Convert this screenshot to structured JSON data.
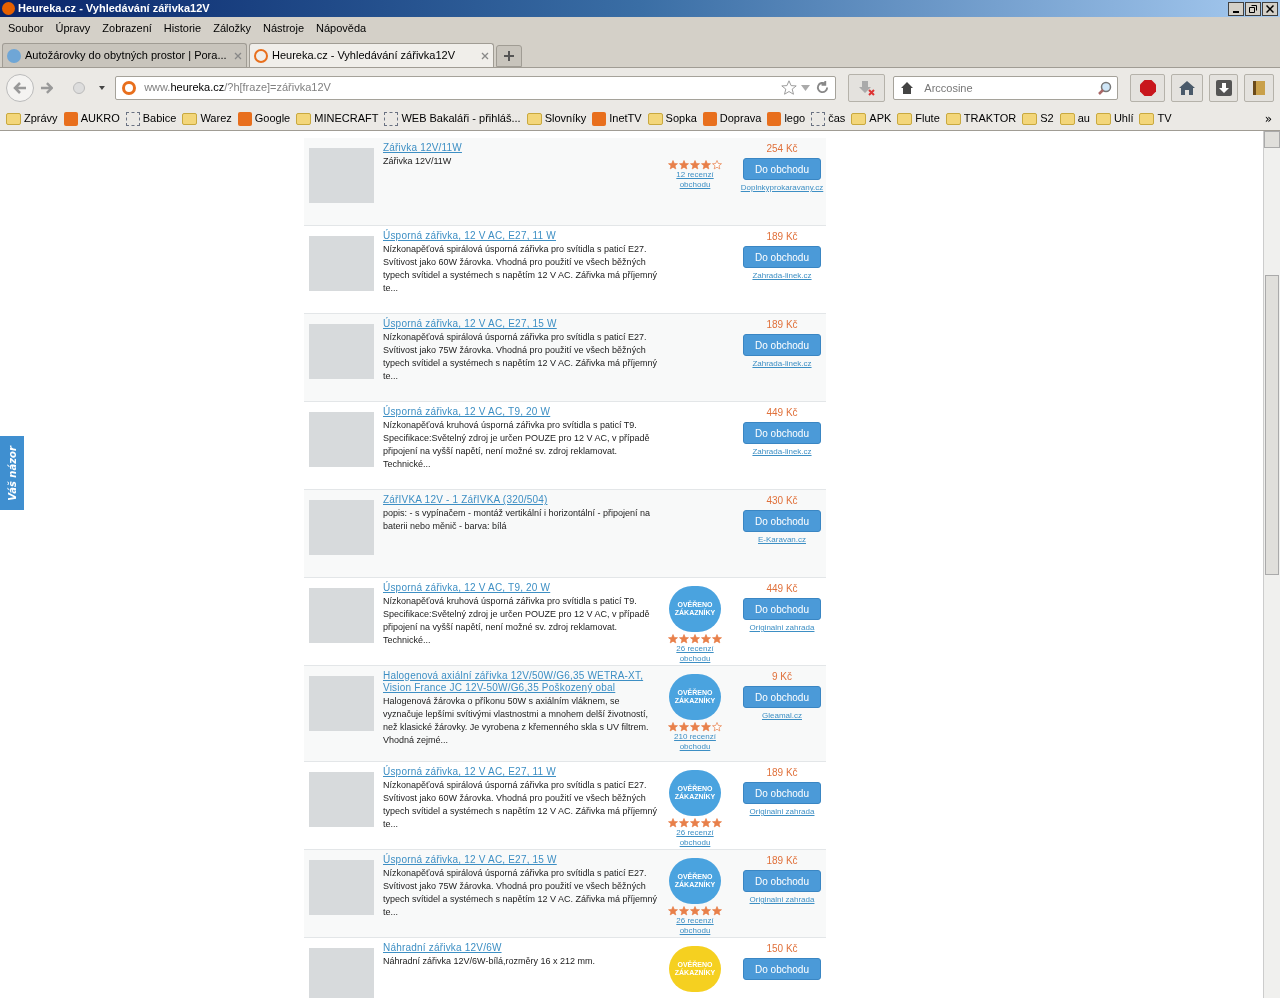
{
  "window": {
    "title": "Heureka.cz - Vyhledávání zářivka12V"
  },
  "menu": [
    "Soubor",
    "Úpravy",
    "Zobrazení",
    "Historie",
    "Záložky",
    "Nástroje",
    "Nápověda"
  ],
  "tabs": [
    {
      "label": "Autožárovky do obytných prostor | Pora...",
      "selected": false
    },
    {
      "label": "Heureka.cz - Vyhledávání zářivka12V",
      "selected": true
    }
  ],
  "address": {
    "url_start": "www.",
    "url_host": "heureka.cz",
    "url_rest": "/?h[fraze]=zářivka12V"
  },
  "search": {
    "placeholder": "Arccosine"
  },
  "bookmarks": [
    {
      "label": "Zprávy",
      "kind": "folder"
    },
    {
      "label": "AUKRO",
      "kind": "site"
    },
    {
      "label": "Babice",
      "kind": "page"
    },
    {
      "label": "Warez",
      "kind": "folder"
    },
    {
      "label": "Google",
      "kind": "site"
    },
    {
      "label": "MINECRAFT",
      "kind": "folder"
    },
    {
      "label": "WEB Bakaláři - přihláš...",
      "kind": "page"
    },
    {
      "label": "Slovníky",
      "kind": "folder"
    },
    {
      "label": "InetTV",
      "kind": "site"
    },
    {
      "label": "Sopka",
      "kind": "folder"
    },
    {
      "label": "Doprava",
      "kind": "site"
    },
    {
      "label": "lego",
      "kind": "site"
    },
    {
      "label": "čas",
      "kind": "page"
    },
    {
      "label": "APK",
      "kind": "folder"
    },
    {
      "label": "Flute",
      "kind": "folder"
    },
    {
      "label": "TRAKTOR",
      "kind": "folder"
    },
    {
      "label": "S2",
      "kind": "folder"
    },
    {
      "label": "au",
      "kind": "folder"
    },
    {
      "label": "Uhlí",
      "kind": "folder"
    },
    {
      "label": "TV",
      "kind": "folder"
    }
  ],
  "bookmarks_more": "»",
  "side_tab": {
    "label": "Váš názor"
  },
  "products": [
    {
      "title": "Zářivka 12V/11W",
      "description": "Zářivka 12V/11W",
      "price": "254 Kč",
      "button": "Do obchodu",
      "shop": "Doplnkyprokaravany.cz",
      "stars": 4,
      "reviews": "12 recenzí obchodu"
    },
    {
      "title": "Úsporná zářivka, 12 V AC, E27, 11 W",
      "description": "Nízkonapěťová spirálová úsporná zářivka pro svítidla s paticí E27. Svítivost jako 60W žárovka. Vhodná pro použití ve všech běžných typech svítidel a systémech s napětím 12 V AC. Zářivka má příjemný te...",
      "price": "189 Kč",
      "button": "Do obchodu",
      "shop": "Zahrada-linek.cz"
    },
    {
      "title": "Úsporná zářivka, 12 V AC, E27, 15 W",
      "description": "Nízkonapěťová spirálová úsporná zářivka pro svítidla s paticí E27. Svítivost jako 75W žárovka. Vhodná pro použití ve všech běžných typech svítidel a systémech s napětím 12 V AC. Zářivka má příjemný te...",
      "price": "189 Kč",
      "button": "Do obchodu",
      "shop": "Zahrada-linek.cz"
    },
    {
      "title": "Úsporná zářivka, 12 V AC, T9, 20 W",
      "description": "Nízkonapěťová kruhová úsporná zářivka pro svítidla s paticí T9. Specifikace:Světelný zdroj je určen POUZE pro 12 V AC, v případě připojení na vyšší napětí, není možné sv. zdroj reklamovat. Technické...",
      "price": "449 Kč",
      "button": "Do obchodu",
      "shop": "Zahrada-linek.cz"
    },
    {
      "title": "ZářIVKA 12V - 1 ZářIVKA (320/504)",
      "description": "popis: - s vypínačem - montáž vertikální i horizontální - připojení na baterii nebo měnič - barva: bílá",
      "price": "430 Kč",
      "button": "Do obchodu",
      "shop": "E-Karavan.cz"
    },
    {
      "title": "Úsporná zářivka, 12 V AC, T9, 20 W",
      "description": "Nízkonapěťová kruhová úsporná zářivka pro svítidla s paticí T9. Specifikace:Světelný zdroj je určen POUZE pro 12 V AC, v případě připojení na vyšší napětí, není možné sv. zdroj reklamovat. Technické...",
      "price": "449 Kč",
      "button": "Do obchodu",
      "shop": "Originalni zahrada",
      "badge_text": "OVĚŘENO ZÁKAZNÍKY",
      "color": "#4aa3df",
      "stars": 5,
      "reviews": "26 recenzí obchodu"
    },
    {
      "title": "Halogenová axiální zářivka 12V/50W/G6,35 WETRA-XT, Vision France JC 12V-50W/G6,35 Poškozený obal",
      "description": "Halogenová žárovka o příkonu 50W s axiálním vláknem, se vyznačuje lepšími svítivými vlastnostmi a mnohem delší životností, než klasické žárovky. Je vyrobena z křemenného skla s UV filtrem. Vhodná zejmé...",
      "price": "9 Kč",
      "button": "Do obchodu",
      "shop": "Gleamal.cz",
      "badge_text": "OVĚŘENO ZÁKAZNÍKY",
      "color": "#4aa3df",
      "stars": 4,
      "reviews": "210 recenzí obchodu"
    },
    {
      "title": "Úsporná zářivka, 12 V AC, E27, 11 W",
      "description": "Nízkonapěťová spirálová úsporná zářivka pro svítidla s paticí E27. Svítivost jako 60W žárovka. Vhodná pro použití ve všech běžných typech svítidel a systémech s napětím 12 V AC. Zářivka má příjemný te...",
      "price": "189 Kč",
      "button": "Do obchodu",
      "shop": "Originalni zahrada",
      "badge_text": "OVĚŘENO ZÁKAZNÍKY",
      "color": "#4aa3df",
      "stars": 5,
      "reviews": "26 recenzí obchodu"
    },
    {
      "title": "Úsporná zářivka, 12 V AC, E27, 15 W",
      "description": "Nízkonapěťová spirálová úsporná zářivka pro svítidla s paticí E27. Svítivost jako 75W žárovka. Vhodná pro použití ve všech běžných typech svítidel a systémech s napětím 12 V AC. Zářivka má příjemný te...",
      "price": "189 Kč",
      "button": "Do obchodu",
      "shop": "Originalni zahrada",
      "badge_text": "OVĚŘENO ZÁKAZNÍKY",
      "color": "#4aa3df",
      "stars": 5,
      "reviews": "26 recenzí obchodu"
    },
    {
      "title": "Náhradní zářivka 12V/6W",
      "description": "Náhradní zářivka 12V/6W-bílá,rozměry 16 x 212 mm.",
      "price": "150 Kč",
      "button": "Do obchodu",
      "badge_text": "OVĚŘENO ZÁKAZNÍKY",
      "color": "#f5d020"
    }
  ]
}
